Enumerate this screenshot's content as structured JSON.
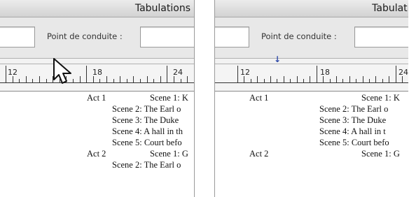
{
  "left": {
    "title": "Tabulations",
    "leader_label": "Point de conduite :",
    "ruler_labels": [
      "12",
      "18",
      "24"
    ],
    "lines": [
      {
        "a": "Act 1",
        "b": "Scene 1: K"
      },
      {
        "b": "Scene 2: The Earl o"
      },
      {
        "b": "Scene 3: The Duke"
      },
      {
        "b": "Scene 4: A hall in th"
      },
      {
        "b": "Scene 5: Court befo"
      },
      {
        "a": "Act 2",
        "b": "Scene 1: G"
      },
      {
        "b": "Scene 2: The Earl o"
      }
    ]
  },
  "right": {
    "title": "Tabulation",
    "leader_label": "Point de conduite :",
    "ruler_labels": [
      "12",
      "18",
      "24"
    ],
    "tab_marker": "↓",
    "lines": [
      {
        "a": "Act 1",
        "b": "Scene 1: K"
      },
      {
        "b": "Scene 2: The Earl o"
      },
      {
        "b": "Scene 3: The Duke"
      },
      {
        "b": "Scene 4: A hall in t"
      },
      {
        "b": "Scene 5: Court befo"
      },
      {
        "a": "Act 2",
        "b": "Scene 1: G"
      }
    ]
  },
  "icons": {
    "pointer": "mouse-pointer-icon",
    "tab_stop": "tab-stop-marker-icon"
  },
  "colors": {
    "marker": "#2f4aa8",
    "toolbar": "#e8e8e8"
  }
}
